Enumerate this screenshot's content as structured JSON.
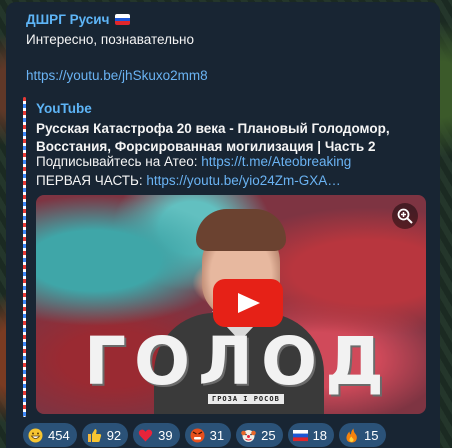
{
  "message": {
    "sender": "ДШРГ Русич",
    "text": "Интересно, познавательно",
    "link": "https://youtu.be/jhSkuxo2mm8"
  },
  "preview": {
    "site": "YouTube",
    "title": "Русская Катастрофа 20 века - Плановый Голодомор, Восстания, Форсированная могилизация | Часть 2",
    "subscribe_prefix": "Подписывайтесь на Атео:",
    "subscribe_link": "https://t.me/Ateobreaking",
    "part_prefix": "ПЕРВАЯ ЧАСТЬ:",
    "part_link": "https://youtu.be/yio24Zm-GXA…",
    "thumbnail": {
      "big_title": "ГОЛОД",
      "small_title": "ГРОЗА I РОСОВ"
    }
  },
  "reactions": [
    {
      "icon": "grin-emoji-icon",
      "count": "454"
    },
    {
      "icon": "thumbs-up-icon",
      "count": "92"
    },
    {
      "icon": "heart-icon",
      "count": "39"
    },
    {
      "icon": "angry-face-icon",
      "count": "31"
    },
    {
      "icon": "clown-face-icon",
      "count": "25"
    },
    {
      "icon": "russian-flag-icon",
      "count": "18"
    },
    {
      "icon": "fire-icon",
      "count": "15"
    }
  ],
  "colors": {
    "bubble": "#182533",
    "accent_link": "#6ab3f3",
    "sender_name": "#5eb5f7",
    "reaction_bg": "#2b5278",
    "play_button": "#e62117"
  }
}
